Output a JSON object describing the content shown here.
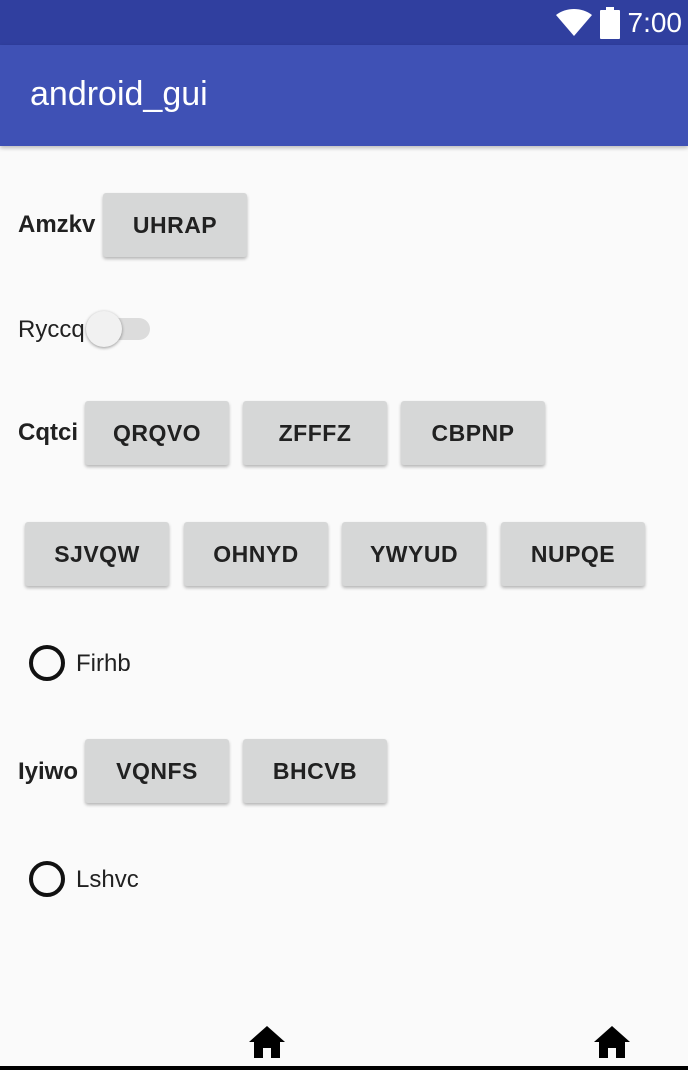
{
  "status_bar": {
    "time": "7:00",
    "icons": [
      "wifi-icon",
      "battery-icon"
    ]
  },
  "app_bar": {
    "title": "android_gui"
  },
  "rows": {
    "amzkv": {
      "label": "Amzkv",
      "button": "UHRAP"
    },
    "ryccq": {
      "label": "Ryccq",
      "switch_on": false
    },
    "cqtci": {
      "label": "Cqtci",
      "buttons": [
        "QRQVO",
        "ZFFFZ",
        "CBPNP"
      ]
    },
    "second_row": {
      "buttons": [
        "SJVQW",
        "OHNYD",
        "YWYUD",
        "NUPQE"
      ]
    },
    "firhb": {
      "label": "Firhb",
      "checked": false
    },
    "iyiwo": {
      "label": "Iyiwo",
      "buttons": [
        "VQNFS",
        "BHCVB"
      ]
    },
    "lshvc": {
      "label": "Lshvc",
      "checked": false
    }
  },
  "nav_bar": {
    "icons": [
      "home-icon",
      "home-icon"
    ]
  },
  "colors": {
    "status_bar": "#303f9f",
    "app_bar": "#3f51b5",
    "button": "#d6d7d7",
    "background": "#fafafa"
  }
}
